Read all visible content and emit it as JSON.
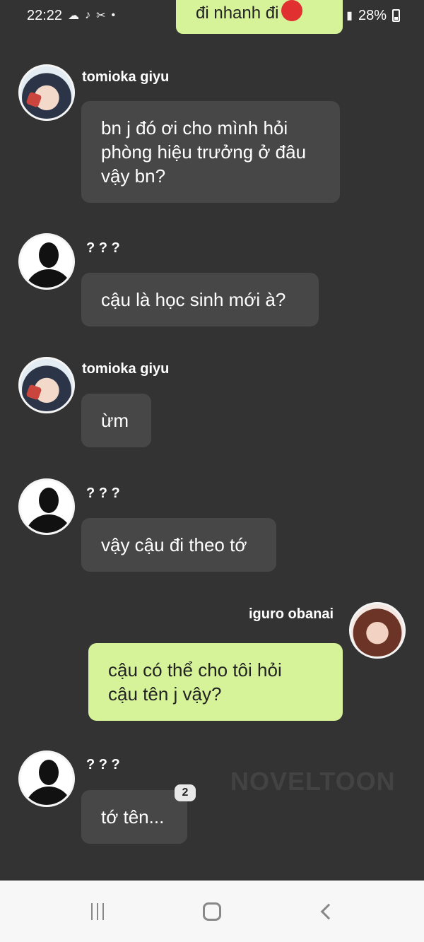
{
  "status_bar": {
    "time": "22:22",
    "battery": "28%"
  },
  "messages": [
    {
      "sender": "",
      "text": "đi nhanh đi"
    },
    {
      "sender": "tomioka giyu",
      "text_lines": [
        "bn j đó ơi cho mình hỏi",
        "phòng hiệu trưởng ở đâu",
        "vậy bn?"
      ]
    },
    {
      "sender": "? ? ?",
      "text": "cậu là học sinh mới à?"
    },
    {
      "sender": "tomioka giyu",
      "text": "ừm"
    },
    {
      "sender": "? ? ?",
      "text": "vậy cậu đi theo tớ"
    },
    {
      "sender": "iguro obanai",
      "text_lines": [
        "cậu có thể cho tôi hỏi",
        "cậu tên j vậy?"
      ]
    },
    {
      "sender": "? ? ?",
      "text": "tớ tên..."
    }
  ],
  "badge_count": "2",
  "watermark": "NOVELTOON",
  "icons": {
    "cloud": "cloud-icon",
    "tiktok": "tiktok-icon",
    "capcut": "capcut-icon",
    "wifi": "wifi-icon",
    "signal": "signal-icon",
    "battery": "battery-icon"
  }
}
